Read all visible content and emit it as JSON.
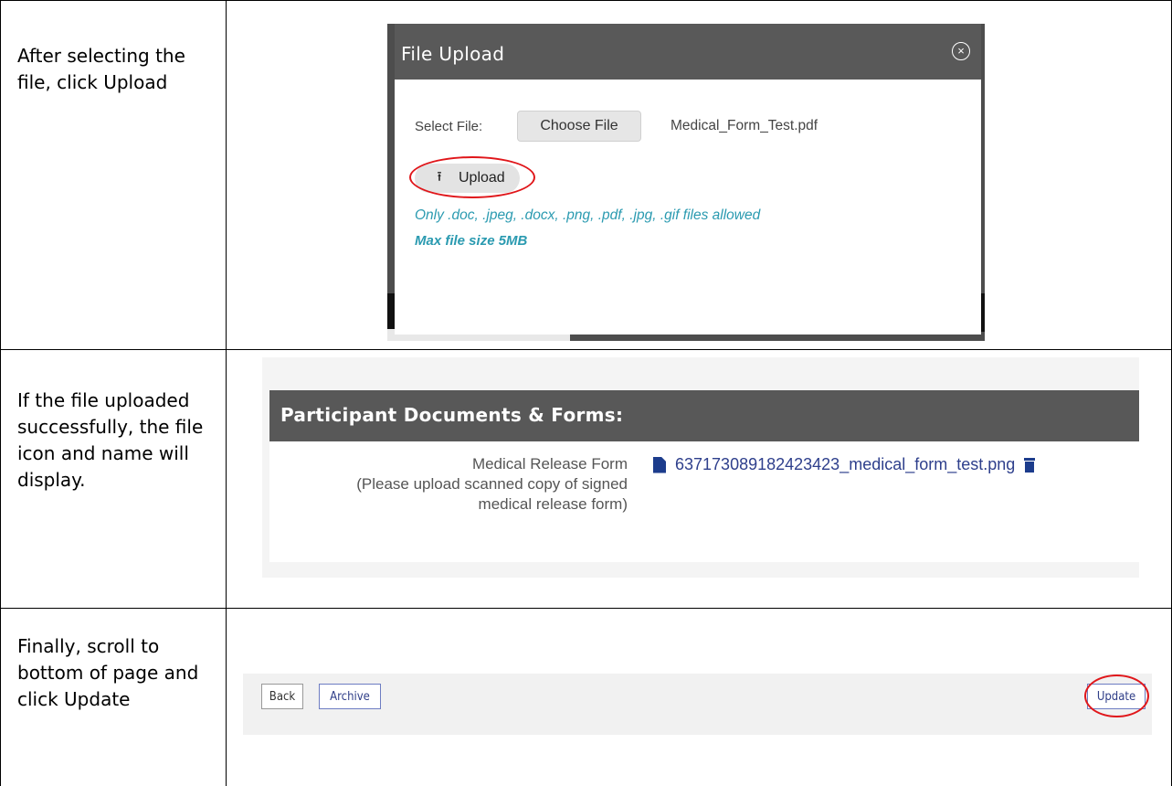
{
  "steps": [
    {
      "instruction": "After selecting the file, click Upload"
    },
    {
      "instruction": "If the file uploaded successfully, the file icon and name will display."
    },
    {
      "instruction": "Finally, scroll to bottom of page and click Update"
    }
  ],
  "upload_modal": {
    "title": "File Upload",
    "close_icon": "close-circle-icon",
    "select_label": "Select File:",
    "choose_button": "Choose File",
    "selected_file": "Medical_Form_Test.pdf",
    "upload_button": "Upload",
    "upload_icon": "upload-arrow-icon",
    "allowed_types_note": "Only .doc, .jpeg, .docx, .png, .pdf, .jpg, .gif files allowed",
    "max_size_note": "Max file size 5MB",
    "highlight_color": "#e0161a",
    "note_color": "#2a9ab0"
  },
  "documents_panel": {
    "title": "Participant Documents & Forms:",
    "field_label": "Medical Release Form",
    "field_hint": "(Please upload scanned copy of signed medical release form)",
    "uploaded_file": "637173089182423423_medical_form_test.png",
    "file_icon": "file-icon",
    "delete_icon": "trash-icon",
    "link_color": "#2e3f8c"
  },
  "footer_buttons": {
    "back": "Back",
    "archive": "Archive",
    "update": "Update"
  }
}
